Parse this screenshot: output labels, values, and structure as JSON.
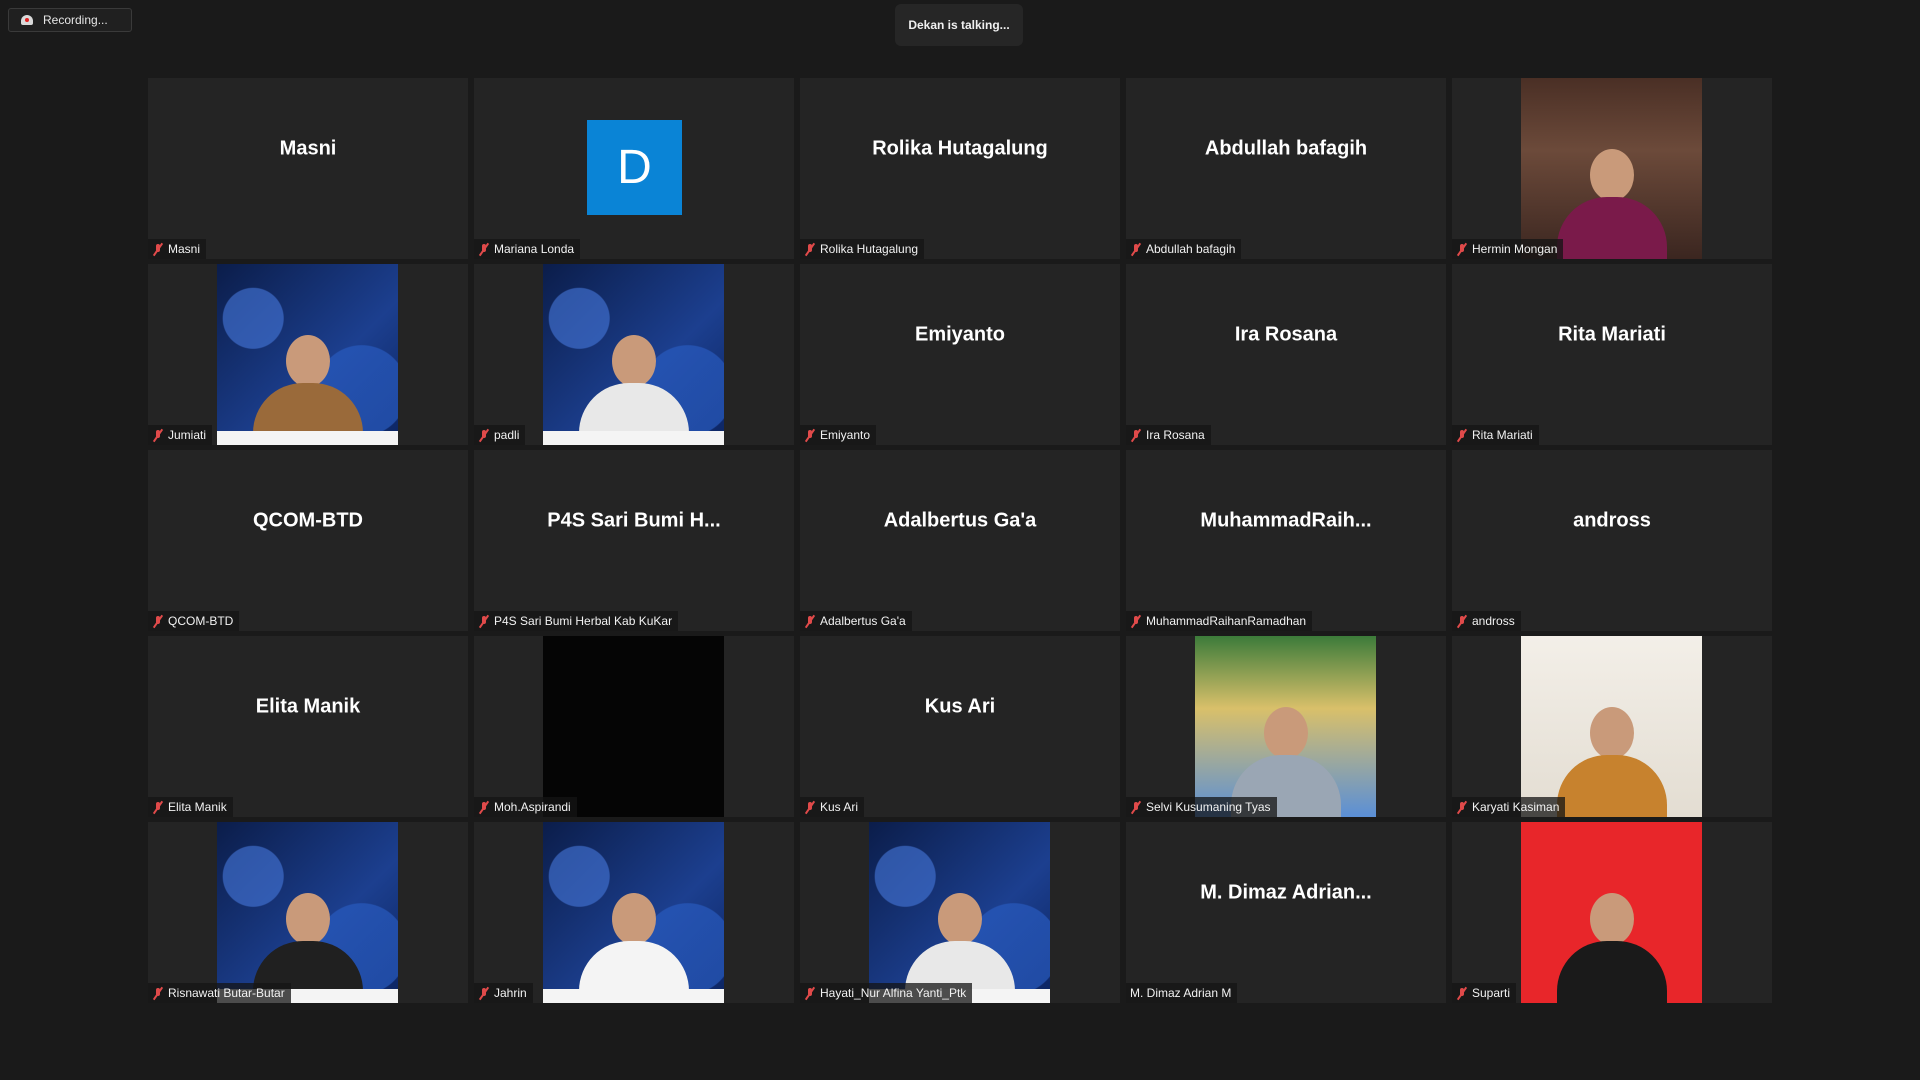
{
  "recording": {
    "label": "Recording..."
  },
  "speaker": {
    "label": "Dekan is talking..."
  },
  "tiles": [
    {
      "name": "Masni",
      "display": "Masni",
      "mic_off": true,
      "kind": "name"
    },
    {
      "name": "Mariana Londa",
      "initial": "D",
      "mic_off": true,
      "kind": "avatar"
    },
    {
      "name": "Rolika Hutagalung",
      "display": "Rolika Hutagalung",
      "mic_off": true,
      "kind": "name"
    },
    {
      "name": "Abdullah bafagih",
      "display": "Abdullah bafagih",
      "mic_off": true,
      "kind": "name"
    },
    {
      "name": "Hermin Mongan",
      "mic_off": true,
      "kind": "video",
      "bg": "room",
      "body": "#7a1a4a"
    },
    {
      "name": "Jumiati",
      "mic_off": true,
      "kind": "video",
      "bg": "blue",
      "body": "#9a6a3a"
    },
    {
      "name": "padli",
      "mic_off": true,
      "kind": "video",
      "bg": "blue",
      "body": "#e8e8e8"
    },
    {
      "name": "Emiyanto",
      "display": "Emiyanto",
      "mic_off": true,
      "kind": "name"
    },
    {
      "name": "Ira Rosana",
      "display": "Ira Rosana",
      "mic_off": true,
      "kind": "name"
    },
    {
      "name": "Rita Mariati",
      "display": "Rita Mariati",
      "mic_off": true,
      "kind": "name"
    },
    {
      "name": "QCOM-BTD",
      "display": "QCOM-BTD",
      "mic_off": true,
      "kind": "name"
    },
    {
      "name": "P4S Sari Bumi Herbal Kab KuKar",
      "display": "P4S Sari Bumi H...",
      "mic_off": true,
      "kind": "name"
    },
    {
      "name": "Adalbertus Ga'a",
      "display": "Adalbertus Ga'a",
      "mic_off": true,
      "kind": "name"
    },
    {
      "name": "MuhammadRaihanRamadhan",
      "display": "MuhammadRaih...",
      "mic_off": true,
      "kind": "name"
    },
    {
      "name": "andross",
      "display": "andross",
      "mic_off": true,
      "kind": "name"
    },
    {
      "name": "Elita Manik",
      "display": "Elita Manik",
      "mic_off": true,
      "kind": "name"
    },
    {
      "name": "Moh.Aspirandi",
      "mic_off": true,
      "kind": "video",
      "bg": "black",
      "body": ""
    },
    {
      "name": "Kus Ari",
      "display": "Kus Ari",
      "mic_off": true,
      "kind": "name"
    },
    {
      "name": "Selvi Kusumaning Tyas",
      "mic_off": true,
      "kind": "video",
      "bg": "grad",
      "body": "#9aa6b4"
    },
    {
      "name": "Karyati Kasiman",
      "mic_off": true,
      "kind": "video",
      "bg": "light",
      "body": "#c7822e"
    },
    {
      "name": "Risnawati Butar-Butar",
      "mic_off": true,
      "kind": "video",
      "bg": "blue",
      "body": "#202020"
    },
    {
      "name": "Jahrin",
      "mic_off": true,
      "kind": "video",
      "bg": "blue",
      "body": "#f4f4f4"
    },
    {
      "name": "Hayati_Nur Alfina Yanti_Ptk",
      "mic_off": true,
      "kind": "video",
      "bg": "blue",
      "body": "#e8e8e8"
    },
    {
      "name": "M. Dimaz Adrian M",
      "display": "M. Dimaz Adrian...",
      "mic_off": false,
      "kind": "name"
    },
    {
      "name": "Suparti",
      "mic_off": true,
      "kind": "video",
      "bg": "red",
      "body": "#1a1a1a"
    }
  ]
}
